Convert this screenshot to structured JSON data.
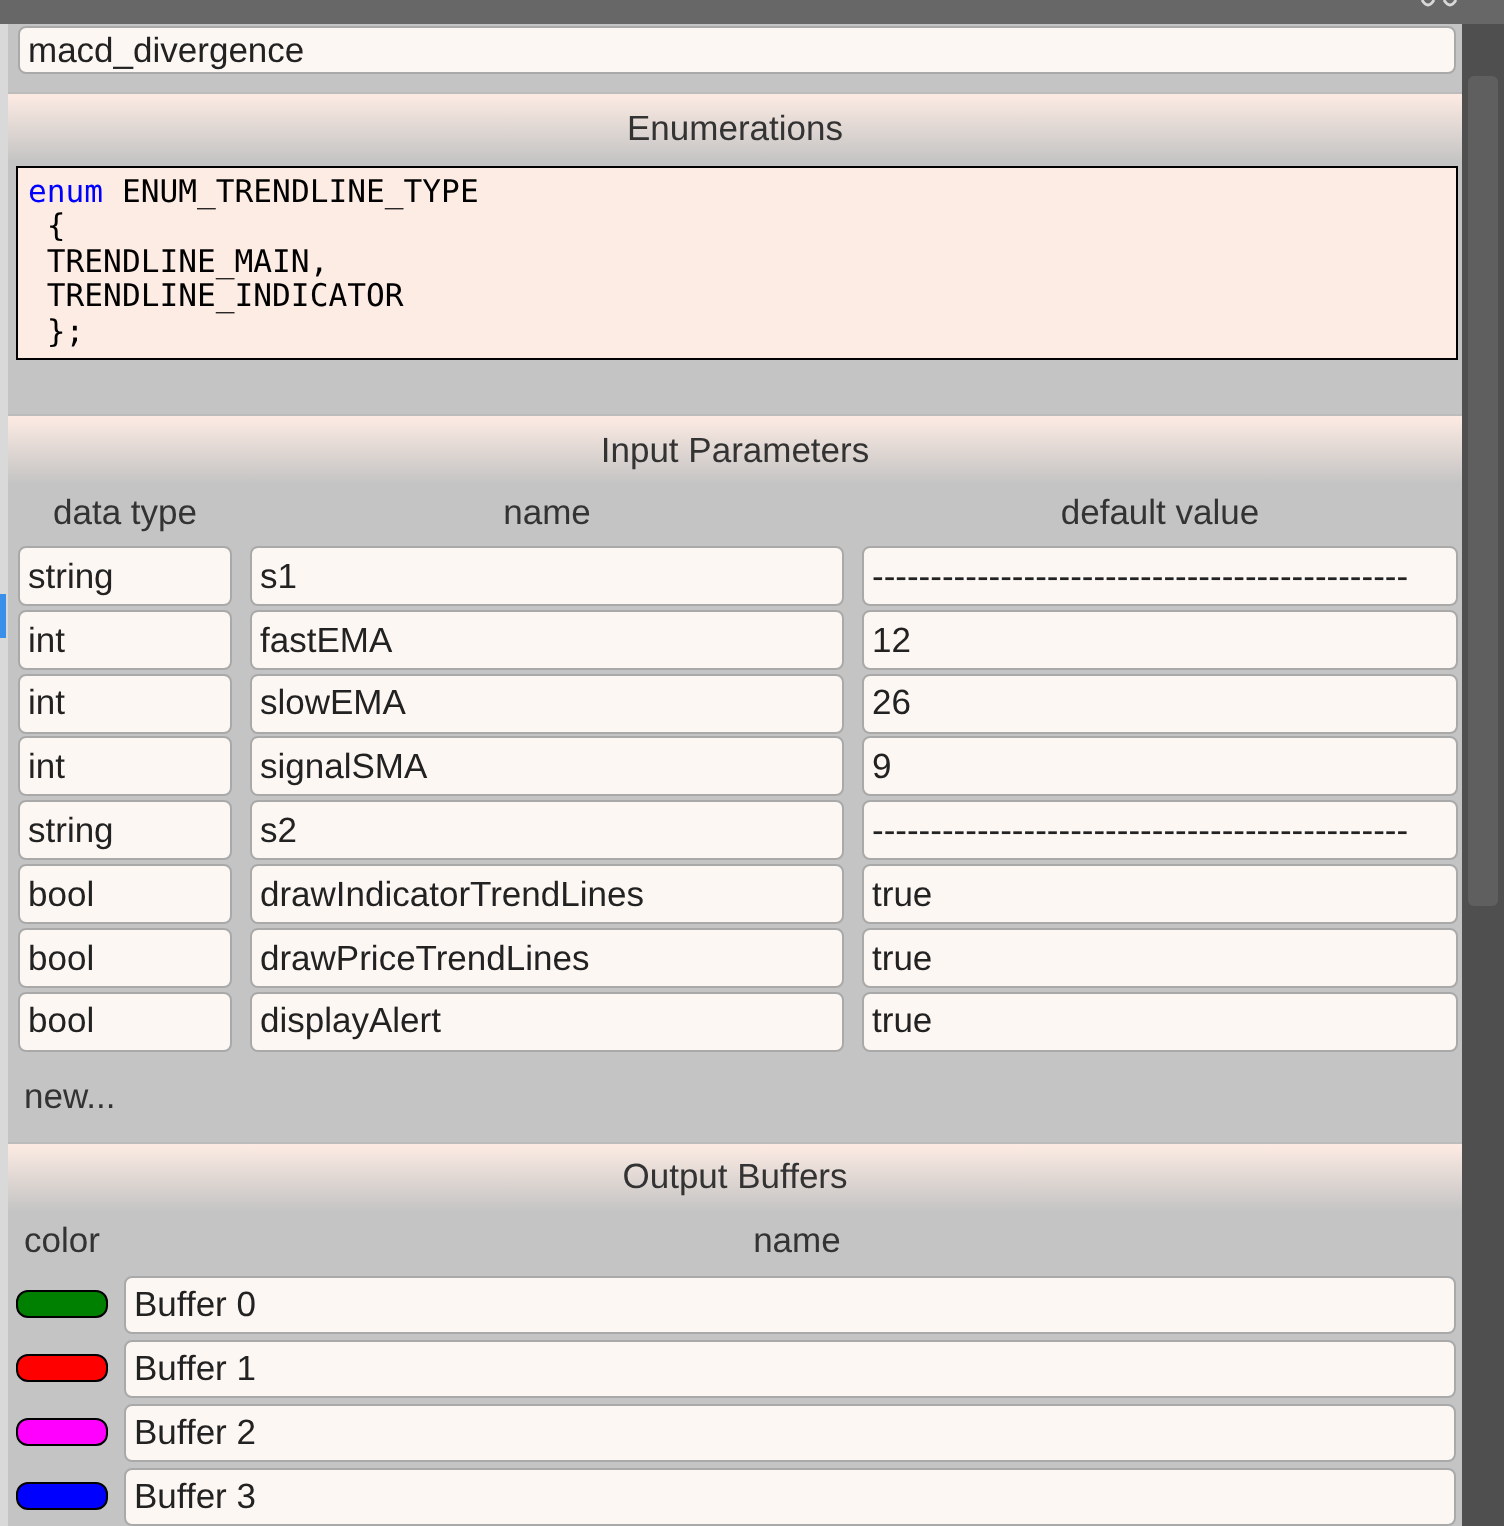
{
  "name_field": {
    "value": "macd_divergence"
  },
  "enumerations": {
    "title": "Enumerations",
    "code_lines": [
      [
        {
          "kind": "keyword",
          "text": "enum"
        },
        {
          "kind": "plain",
          "text": " ENUM_TRENDLINE_TYPE"
        }
      ],
      [
        {
          "kind": "plain",
          "text": " {"
        }
      ],
      [
        {
          "kind": "plain",
          "text": " TRENDLINE_MAIN,"
        }
      ],
      [
        {
          "kind": "plain",
          "text": " TRENDLINE_INDICATOR"
        }
      ],
      [
        {
          "kind": "plain",
          "text": " };"
        }
      ]
    ]
  },
  "input_parameters": {
    "title": "Input Parameters",
    "columns": [
      "data type",
      "name",
      "default value"
    ],
    "rows": [
      {
        "data_type": "string",
        "name": "s1",
        "default_value": "----------------------------------------------"
      },
      {
        "data_type": "int",
        "name": "fastEMA",
        "default_value": "12"
      },
      {
        "data_type": "int",
        "name": "slowEMA",
        "default_value": "26"
      },
      {
        "data_type": "int",
        "name": "signalSMA",
        "default_value": "9"
      },
      {
        "data_type": "string",
        "name": "s2",
        "default_value": "----------------------------------------------"
      },
      {
        "data_type": "bool",
        "name": "drawIndicatorTrendLines",
        "default_value": "true"
      },
      {
        "data_type": "bool",
        "name": "drawPriceTrendLines",
        "default_value": "true"
      },
      {
        "data_type": "bool",
        "name": "displayAlert",
        "default_value": "true"
      }
    ],
    "new_link": "new..."
  },
  "output_buffers": {
    "title": "Output Buffers",
    "columns": [
      "color",
      "name"
    ],
    "rows": [
      {
        "color": "#008000",
        "name": "Buffer 0"
      },
      {
        "color": "#ff0000",
        "name": "Buffer 1"
      },
      {
        "color": "#ff00ff",
        "name": "Buffer 2"
      },
      {
        "color": "#0000ff",
        "name": "Buffer 3"
      }
    ]
  }
}
